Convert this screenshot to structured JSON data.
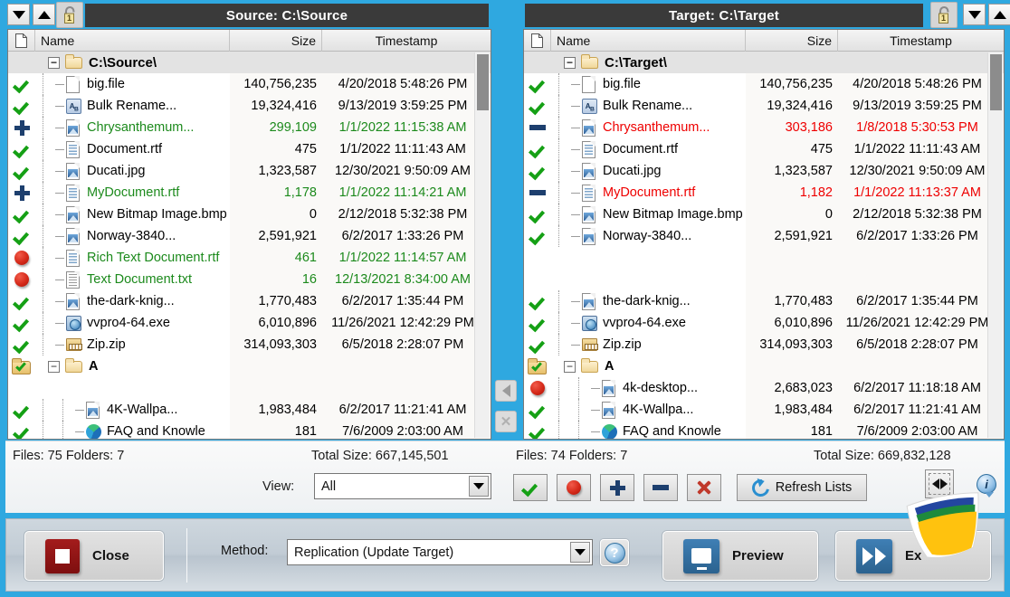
{
  "window": {
    "accent_color": "#2fa8e0",
    "source_title": "Source: C:\\Source",
    "target_title": "Target: C:\\Target"
  },
  "toolbar": {
    "left": [
      {
        "name": "scroll-down-button",
        "icon": "triangle-down-icon"
      },
      {
        "name": "scroll-up-button",
        "icon": "triangle-up-icon"
      },
      {
        "name": "lock-button",
        "icon": "lock-open-icon",
        "label": "1"
      }
    ],
    "right": [
      {
        "name": "lock-button",
        "icon": "lock-open-icon",
        "label": "1"
      },
      {
        "name": "scroll-down-button",
        "icon": "triangle-down-icon"
      },
      {
        "name": "scroll-up-button",
        "icon": "triangle-up-icon"
      }
    ]
  },
  "columns": {
    "icon": "",
    "name": "Name",
    "size": "Size",
    "timestamp": "Timestamp"
  },
  "source": {
    "root": "C:\\Source\\",
    "files_label": "Files: 75  Folders: 7",
    "total_label": "Total Size: 667,145,501",
    "rows": [
      {
        "status": "check",
        "icon": "file-blank-icon",
        "name": "big.file",
        "size": "140,756,235",
        "time": "4/20/2018 5:48:26 PM",
        "color": "black",
        "depth": 1
      },
      {
        "status": "check",
        "icon": "bulk-rename-icon",
        "name": "Bulk Rename...",
        "size": "19,324,416",
        "time": "9/13/2019 3:59:25 PM",
        "color": "black",
        "depth": 1
      },
      {
        "status": "plus",
        "icon": "image-file-icon",
        "name": "Chrysanthemum...",
        "size": "299,109",
        "time": "1/1/2022 11:15:38 AM",
        "color": "green",
        "depth": 1
      },
      {
        "status": "check",
        "icon": "rtf-file-icon",
        "name": "Document.rtf",
        "size": "475",
        "time": "1/1/2022 11:11:43 AM",
        "color": "black",
        "depth": 1
      },
      {
        "status": "check",
        "icon": "image-file-icon",
        "name": "Ducati.jpg",
        "size": "1,323,587",
        "time": "12/30/2021 9:50:09 AM",
        "color": "black",
        "depth": 1
      },
      {
        "status": "plus",
        "icon": "rtf-file-icon",
        "name": "MyDocument.rtf",
        "size": "1,178",
        "time": "1/1/2022 11:14:21 AM",
        "color": "green",
        "depth": 1
      },
      {
        "status": "check",
        "icon": "image-file-icon",
        "name": "New Bitmap Image.bmp",
        "size": "0",
        "time": "2/12/2018 5:32:38 PM",
        "color": "black",
        "depth": 1
      },
      {
        "status": "check",
        "icon": "image-file-icon",
        "name": "Norway-3840...",
        "size": "2,591,921",
        "time": "6/2/2017 1:33:26 PM",
        "color": "black",
        "depth": 1
      },
      {
        "status": "dot",
        "icon": "rtf-file-icon",
        "name": "Rich Text Document.rtf",
        "size": "461",
        "time": "1/1/2022 11:14:57 AM",
        "color": "green",
        "depth": 1
      },
      {
        "status": "dot",
        "icon": "txt-file-icon",
        "name": "Text Document.txt",
        "size": "16",
        "time": "12/13/2021 8:34:00 AM",
        "color": "green",
        "depth": 1
      },
      {
        "status": "check",
        "icon": "image-file-icon",
        "name": "the-dark-knig...",
        "size": "1,770,483",
        "time": "6/2/2017 1:35:44 PM",
        "color": "black",
        "depth": 1
      },
      {
        "status": "check",
        "icon": "exe-file-icon",
        "name": "vvpro4-64.exe",
        "size": "6,010,896",
        "time": "11/26/2021 12:42:29 PM",
        "color": "black",
        "depth": 1
      },
      {
        "status": "check",
        "icon": "zip-file-icon",
        "name": "Zip.zip",
        "size": "314,093,303",
        "time": "6/5/2018 2:28:07 PM",
        "color": "black",
        "depth": 1
      },
      {
        "status": "folder-check",
        "icon": "folder-icon",
        "name": "A",
        "size": "",
        "time": "",
        "color": "black",
        "depth": 1,
        "is_folder": true,
        "expander": "-"
      },
      {
        "status": "",
        "icon": "",
        "name": "",
        "size": "",
        "time": "",
        "color": "black",
        "depth": 2,
        "blank": true
      },
      {
        "status": "check",
        "icon": "image-file-icon",
        "name": "4K-Wallpa...",
        "size": "1,983,484",
        "time": "6/2/2017 11:21:41 AM",
        "color": "black",
        "depth": 2
      },
      {
        "status": "check",
        "icon": "edge-file-icon",
        "name": "FAQ and Knowle",
        "size": "181",
        "time": "7/6/2009 2:03:00 AM",
        "color": "black",
        "depth": 2
      }
    ]
  },
  "target": {
    "root": "C:\\Target\\",
    "files_label": "Files: 74  Folders: 7",
    "total_label": "Total Size: 669,832,128",
    "rows": [
      {
        "status": "check",
        "icon": "file-blank-icon",
        "name": "big.file",
        "size": "140,756,235",
        "time": "4/20/2018 5:48:26 PM",
        "color": "black",
        "depth": 1
      },
      {
        "status": "check",
        "icon": "bulk-rename-icon",
        "name": "Bulk Rename...",
        "size": "19,324,416",
        "time": "9/13/2019 3:59:25 PM",
        "color": "black",
        "depth": 1
      },
      {
        "status": "minus",
        "icon": "image-file-icon",
        "name": "Chrysanthemum...",
        "size": "303,186",
        "time": "1/8/2018 5:30:53 PM",
        "color": "red",
        "depth": 1
      },
      {
        "status": "check",
        "icon": "rtf-file-icon",
        "name": "Document.rtf",
        "size": "475",
        "time": "1/1/2022 11:11:43 AM",
        "color": "black",
        "depth": 1
      },
      {
        "status": "check",
        "icon": "image-file-icon",
        "name": "Ducati.jpg",
        "size": "1,323,587",
        "time": "12/30/2021 9:50:09 AM",
        "color": "black",
        "depth": 1
      },
      {
        "status": "minus",
        "icon": "rtf-file-icon",
        "name": "MyDocument.rtf",
        "size": "1,182",
        "time": "1/1/2022 11:13:37 AM",
        "color": "red",
        "depth": 1
      },
      {
        "status": "check",
        "icon": "image-file-icon",
        "name": "New Bitmap Image.bmp",
        "size": "0",
        "time": "2/12/2018 5:32:38 PM",
        "color": "black",
        "depth": 1
      },
      {
        "status": "check",
        "icon": "image-file-icon",
        "name": "Norway-3840...",
        "size": "2,591,921",
        "time": "6/2/2017 1:33:26 PM",
        "color": "black",
        "depth": 1
      },
      {
        "status": "",
        "icon": "",
        "name": "",
        "size": "",
        "time": "",
        "color": "black",
        "depth": 1,
        "blank": true
      },
      {
        "status": "",
        "icon": "",
        "name": "",
        "size": "",
        "time": "",
        "color": "black",
        "depth": 1,
        "blank": true
      },
      {
        "status": "check",
        "icon": "image-file-icon",
        "name": "the-dark-knig...",
        "size": "1,770,483",
        "time": "6/2/2017 1:35:44 PM",
        "color": "black",
        "depth": 1
      },
      {
        "status": "check",
        "icon": "exe-file-icon",
        "name": "vvpro4-64.exe",
        "size": "6,010,896",
        "time": "11/26/2021 12:42:29 PM",
        "color": "black",
        "depth": 1
      },
      {
        "status": "check",
        "icon": "zip-file-icon",
        "name": "Zip.zip",
        "size": "314,093,303",
        "time": "6/5/2018 2:28:07 PM",
        "color": "black",
        "depth": 1
      },
      {
        "status": "folder-check",
        "icon": "folder-icon",
        "name": "A",
        "size": "",
        "time": "",
        "color": "black",
        "depth": 1,
        "is_folder": true,
        "expander": "-"
      },
      {
        "status": "dot",
        "icon": "image-file-icon",
        "name": "4k-desktop...",
        "size": "2,683,023",
        "time": "6/2/2017 11:18:18 AM",
        "color": "black",
        "depth": 2
      },
      {
        "status": "check",
        "icon": "image-file-icon",
        "name": "4K-Wallpa...",
        "size": "1,983,484",
        "time": "6/2/2017 11:21:41 AM",
        "color": "black",
        "depth": 2
      },
      {
        "status": "check",
        "icon": "edge-file-icon",
        "name": "FAQ and Knowle",
        "size": "181",
        "time": "7/6/2009 2:03:00 AM",
        "color": "black",
        "depth": 2
      }
    ]
  },
  "mid_buttons": [
    {
      "name": "copy-left-button",
      "icon": "arrow-left-icon"
    },
    {
      "name": "clear-selection-button",
      "icon": "close-x-icon"
    }
  ],
  "view": {
    "label": "View:",
    "value": "All"
  },
  "selection_buttons": [
    {
      "name": "mark-equal-button",
      "icon": "check-icon"
    },
    {
      "name": "mark-different-button",
      "icon": "red-dot-icon"
    },
    {
      "name": "mark-add-button",
      "icon": "plus-icon"
    },
    {
      "name": "mark-remove-button",
      "icon": "minus-icon"
    },
    {
      "name": "mark-none-button",
      "icon": "x-icon"
    }
  ],
  "refresh": {
    "label": "Refresh Lists",
    "icon": "refresh-icon"
  },
  "splitter": {
    "name": "splitter-button",
    "icon": "split-horizontal-icon"
  },
  "info": {
    "name": "info-button",
    "icon": "info-icon",
    "glyph": "i"
  },
  "actions": {
    "close_label": "Close",
    "method_label": "Method:",
    "method_value": "Replication (Update Target)",
    "help_glyph": "?",
    "preview_label": "Preview",
    "execute_label": "Ex"
  }
}
